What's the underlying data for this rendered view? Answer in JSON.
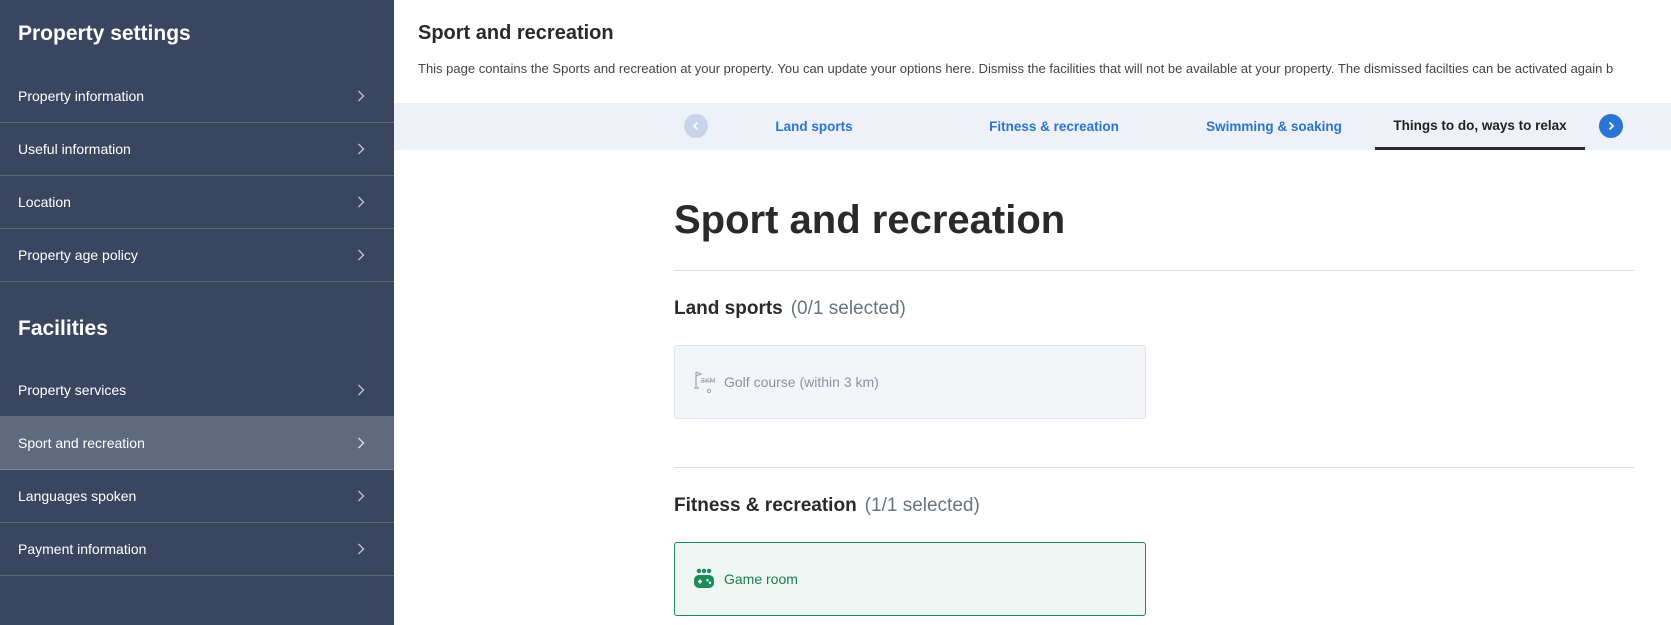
{
  "sidebar": {
    "sections": [
      {
        "heading": "Property settings",
        "items": [
          {
            "label": "Property information",
            "active": false
          },
          {
            "label": "Useful information",
            "active": false
          },
          {
            "label": "Location",
            "active": false
          },
          {
            "label": "Property age policy",
            "active": false
          }
        ]
      },
      {
        "heading": "Facilities",
        "items": [
          {
            "label": "Property services",
            "active": false
          },
          {
            "label": "Sport and recreation",
            "active": true
          },
          {
            "label": "Languages spoken",
            "active": false
          },
          {
            "label": "Payment information",
            "active": false
          }
        ]
      }
    ]
  },
  "header": {
    "title": "Sport and recreation",
    "description": "This page contains the Sports and recreation at your property. You can update your options here. Dismiss the facilities that will not be available at your property. The dismissed facilties can be activated again b"
  },
  "tabs": [
    {
      "label": "Land sports",
      "active": false
    },
    {
      "label": "Fitness & recreation",
      "active": false
    },
    {
      "label": "Swimming & soaking",
      "active": false
    },
    {
      "label": "Things to do, ways to relax",
      "active": true
    }
  ],
  "content": {
    "title": "Sport and recreation",
    "sections": [
      {
        "title": "Land sports",
        "count": "(0/1 selected)",
        "facilities": [
          {
            "label": "Golf course (within 3 km)",
            "icon": "golf-course-icon",
            "selected": false
          }
        ]
      },
      {
        "title": "Fitness & recreation",
        "count": "(1/1 selected)",
        "facilities": [
          {
            "label": "Game room",
            "icon": "game-controller-icon",
            "selected": true
          }
        ]
      }
    ]
  },
  "colors": {
    "sidebar_bg": "#3a4660",
    "sidebar_active": "#5f6a80",
    "link_blue": "#2a74d6",
    "selected_green": "#1f8a5b"
  }
}
